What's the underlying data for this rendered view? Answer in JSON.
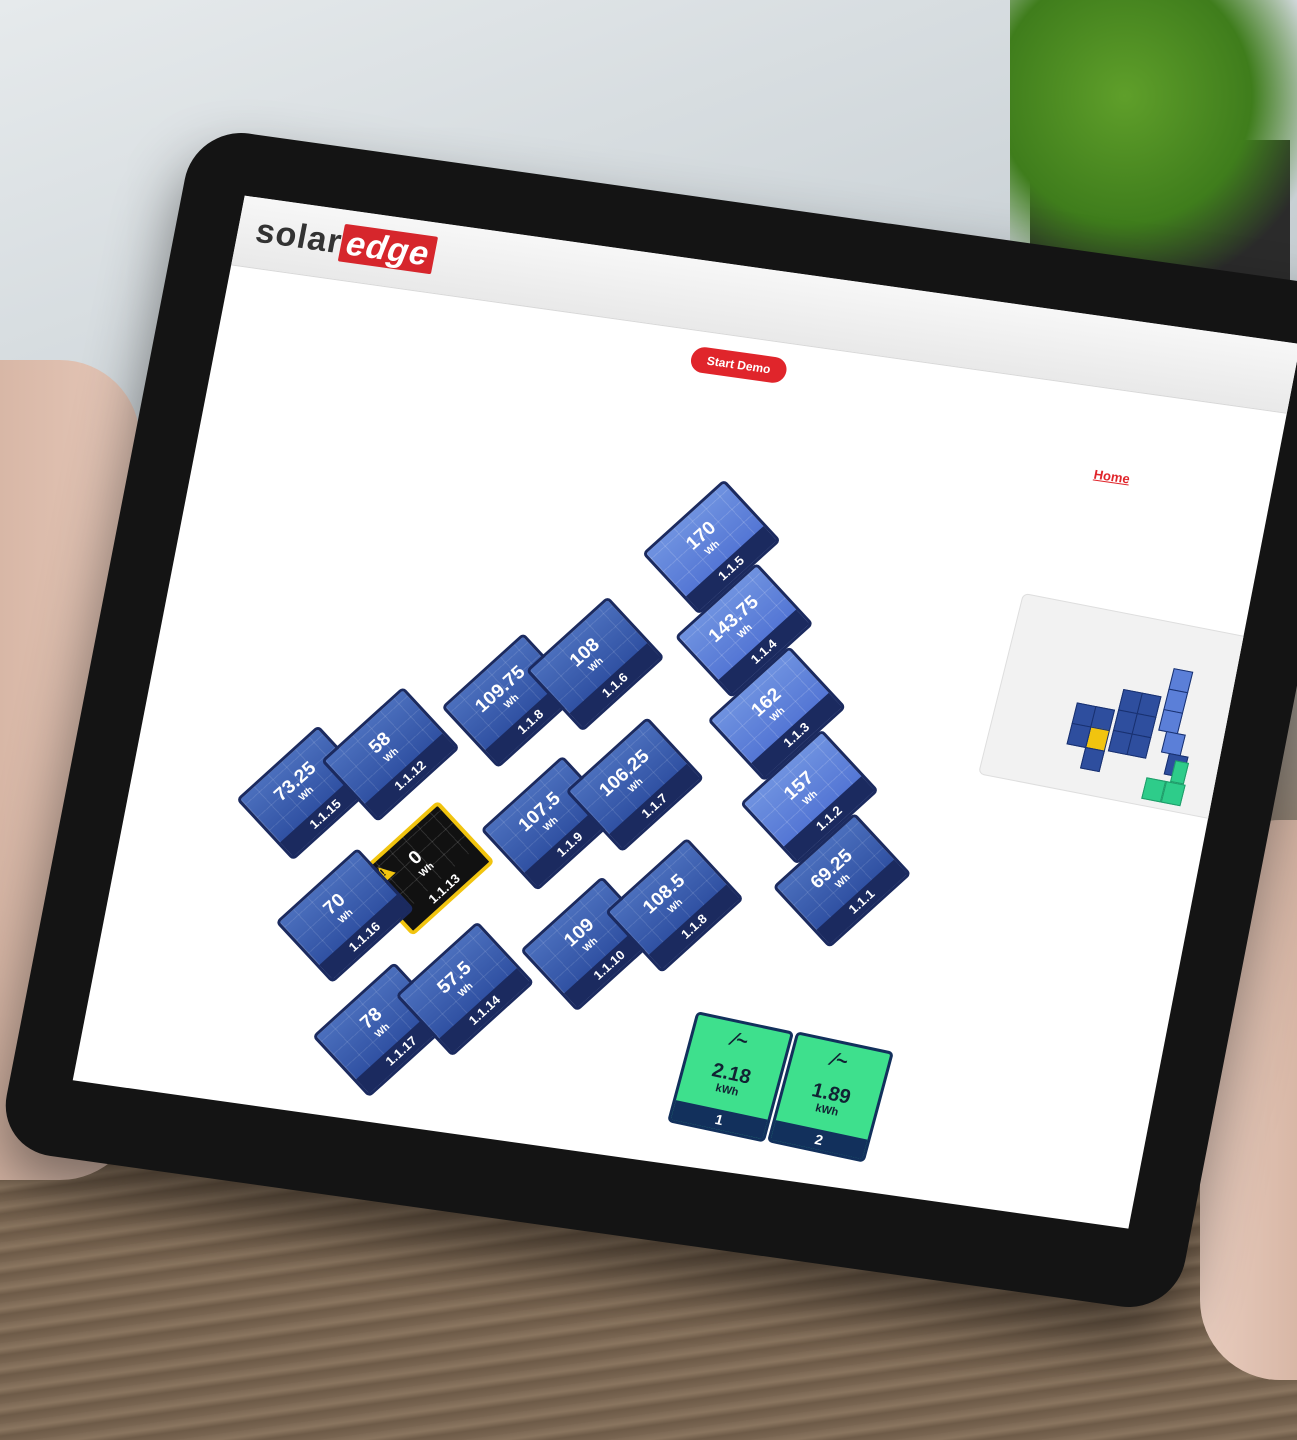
{
  "header": {
    "logo_solar": "solar",
    "logo_edge": "edge",
    "start_demo": "Start Demo",
    "home": "Home"
  },
  "colors": {
    "accent": "#e0252b",
    "panel_dark": "#27479a",
    "panel_light": "#4b6dd1",
    "fault": "#f1c40f",
    "inverter": "#3ee08d"
  },
  "panels": [
    {
      "id": "1.1.15",
      "value": "73.25",
      "unit": "Wh"
    },
    {
      "id": "1.1.12",
      "value": "58",
      "unit": "Wh"
    },
    {
      "id": "1.1.13",
      "value": "0",
      "unit": "Wh",
      "fault": true
    },
    {
      "id": "1.1.16",
      "value": "70",
      "unit": "Wh"
    },
    {
      "id": "1.1.17",
      "value": "78",
      "unit": "Wh"
    },
    {
      "id": "1.1.14",
      "value": "57.5",
      "unit": "Wh"
    },
    {
      "id": "1.1.8",
      "value": "109.75",
      "unit": "Wh"
    },
    {
      "id": "1.1.6",
      "value": "108",
      "unit": "Wh"
    },
    {
      "id": "1.1.9",
      "value": "107.5",
      "unit": "Wh"
    },
    {
      "id": "1.1.7",
      "value": "106.25",
      "unit": "Wh"
    },
    {
      "id": "1.1.10",
      "value": "109",
      "unit": "Wh"
    },
    {
      "id": "1.1.8",
      "value": "108.5",
      "unit": "Wh"
    },
    {
      "id": "1.1.5",
      "value": "170",
      "unit": "Wh",
      "light": true
    },
    {
      "id": "1.1.4",
      "value": "143.75",
      "unit": "Wh",
      "light": true
    },
    {
      "id": "1.1.3",
      "value": "162",
      "unit": "Wh",
      "light": true
    },
    {
      "id": "1.1.2",
      "value": "157",
      "unit": "Wh",
      "light": true
    },
    {
      "id": "1.1.1",
      "value": "69.25",
      "unit": "Wh"
    }
  ],
  "inverters": [
    {
      "id": "1",
      "value": "2.18",
      "unit": "kWh"
    },
    {
      "id": "2",
      "value": "1.89",
      "unit": "kWh"
    }
  ],
  "icons": {
    "warning": "warning-icon",
    "inverter": "inverter-icon"
  }
}
